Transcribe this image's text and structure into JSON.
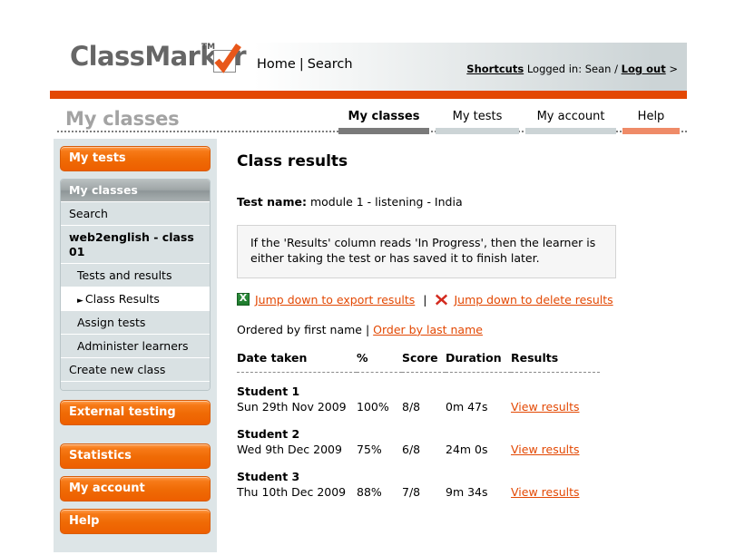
{
  "brand": {
    "name": "ClassMarker",
    "tm": "TM",
    "check_icon": "orange-checkmark-icon"
  },
  "header": {
    "nav": {
      "home": "Home",
      "separator": "|",
      "search": "Search"
    },
    "shortcuts": "Shortcuts",
    "logged_in_prefix": "Logged in: Sean /",
    "logout": "Log out",
    "arrow": ">",
    "accent_color": "#e34803"
  },
  "title_row": {
    "page_title": "My classes",
    "tabs": [
      {
        "label": "My classes",
        "active": true,
        "underline_color": "#7a7a7a"
      },
      {
        "label": "My tests",
        "active": false,
        "underline_color": "#ccd4d6"
      },
      {
        "label": "My account",
        "active": false,
        "underline_color": "#ccd4d6"
      },
      {
        "label": "Help",
        "active": false,
        "underline_color": "#ef8b68"
      }
    ]
  },
  "sidebar": {
    "my_tests_button": "My tests",
    "classes_panel_header": "My classes",
    "classes_items": [
      {
        "label": "Search",
        "style": "plain"
      },
      {
        "label": "web2english - class 01",
        "style": "classname"
      },
      {
        "label": "Tests and results",
        "style": "indent"
      },
      {
        "label": "Class Results",
        "style": "selected",
        "marker": "triangle-right-icon"
      },
      {
        "label": "Assign tests",
        "style": "indent"
      },
      {
        "label": "Administer learners",
        "style": "indent"
      },
      {
        "label": "Create new class",
        "style": "plain"
      }
    ],
    "external_testing_button": "External testing",
    "statistics_button": "Statistics",
    "my_account_button": "My account",
    "help_button": "Help"
  },
  "main": {
    "heading": "Class results",
    "test_name_label": "Test name:",
    "test_name_value": "module 1 - listening - India",
    "notice": "If the 'Results' column reads 'In Progress', then the learner is either taking the test or has saved it to finish later.",
    "export_link": "Jump down to export results",
    "export_icon": "excel-spreadsheet-icon",
    "link_separator": "|",
    "delete_link": "Jump down to delete results",
    "delete_icon": "red-x-icon",
    "ordered_by_text": "Ordered by first name |",
    "order_by_last_name": "Order by last name",
    "table": {
      "columns": [
        "Date taken",
        "%",
        "Score",
        "Duration",
        "Results"
      ],
      "rows": [
        {
          "student": "Student 1",
          "date": "Sun 29th Nov 2009",
          "percent": "100%",
          "score": "8/8",
          "duration": "0m 47s",
          "result_link": "View results"
        },
        {
          "student": "Student 2",
          "date": "Wed 9th Dec 2009",
          "percent": "75%",
          "score": "6/8",
          "duration": "24m 0s",
          "result_link": "View results"
        },
        {
          "student": "Student 3",
          "date": "Thu 10th Dec 2009",
          "percent": "88%",
          "score": "7/8",
          "duration": "9m 34s",
          "result_link": "View results"
        }
      ]
    }
  }
}
